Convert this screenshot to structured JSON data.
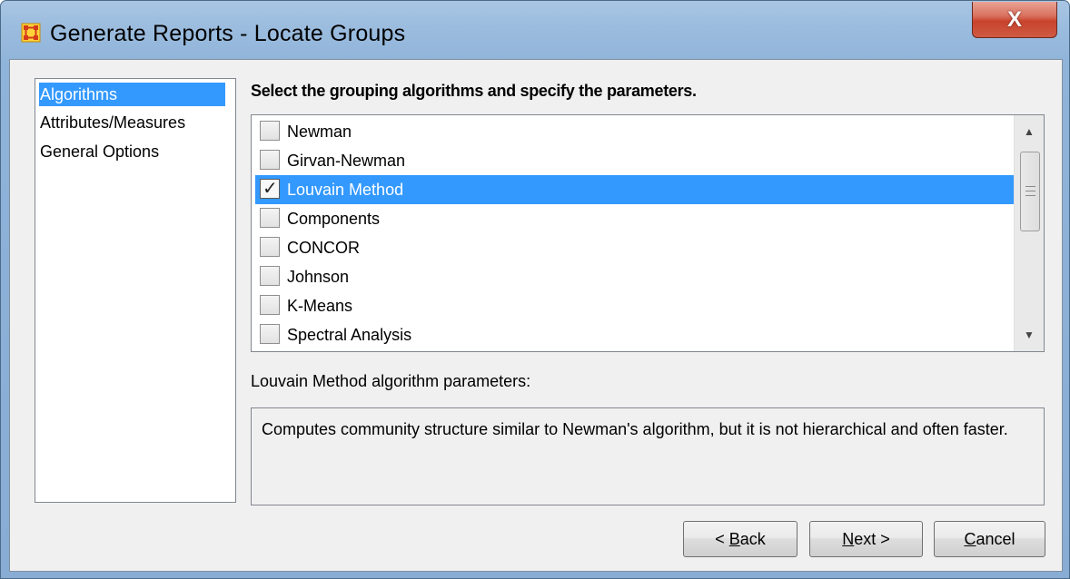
{
  "window": {
    "title": "Generate Reports - Locate Groups",
    "close_label": "X"
  },
  "colors": {
    "selection": "#3399ff",
    "panel": "#f0f0f0",
    "close": "#c8432c"
  },
  "sidebar": {
    "items": [
      {
        "label": "Algorithms",
        "selected": true
      },
      {
        "label": "Attributes/Measures",
        "selected": false
      },
      {
        "label": "General Options",
        "selected": false
      }
    ]
  },
  "main": {
    "heading": "Select the grouping algorithms and specify the parameters.",
    "algorithms": [
      {
        "label": "Newman",
        "checked": false,
        "selected": false
      },
      {
        "label": "Girvan-Newman",
        "checked": false,
        "selected": false
      },
      {
        "label": "Louvain Method",
        "checked": true,
        "selected": true
      },
      {
        "label": "Components",
        "checked": false,
        "selected": false
      },
      {
        "label": "CONCOR",
        "checked": false,
        "selected": false
      },
      {
        "label": "Johnson",
        "checked": false,
        "selected": false
      },
      {
        "label": "K-Means",
        "checked": false,
        "selected": false
      },
      {
        "label": "Spectral Analysis",
        "checked": false,
        "selected": false
      }
    ],
    "params_label": "Louvain Method algorithm parameters:",
    "description": "Computes community structure similar to Newman's algorithm, but it is not hierarchical and often faster."
  },
  "buttons": {
    "back": {
      "mnemonic": "B",
      "rest": "ack",
      "prefix": "< ",
      "suffix": ""
    },
    "next": {
      "mnemonic": "N",
      "rest": "ext",
      "prefix": "",
      "suffix": " >"
    },
    "cancel": {
      "mnemonic": "C",
      "rest": "ancel",
      "prefix": "",
      "suffix": ""
    }
  },
  "icons": {
    "app": "network-grid-icon",
    "close": "close-icon",
    "scroll_up": "scroll-up-arrow-icon",
    "scroll_down": "scroll-down-arrow-icon",
    "check": "checkmark-icon"
  }
}
